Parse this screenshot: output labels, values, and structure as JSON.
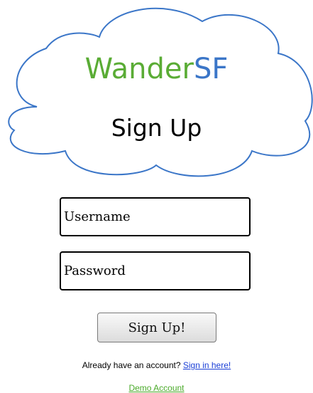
{
  "header": {
    "logo_part1": "Wander",
    "logo_part2": "SF",
    "title": "Sign Up"
  },
  "form": {
    "username_placeholder": "Username",
    "password_placeholder": "Password",
    "submit_label": "Sign Up!"
  },
  "footer": {
    "signin_prompt": "Already have an account?",
    "signin_link": "Sign in here!",
    "demo_link": "Demo Account"
  },
  "colors": {
    "brand_green": "#5aac35",
    "brand_blue": "#3b76c8",
    "cloud_outline": "#3b76c8",
    "signin_link": "#1a3fd6",
    "demo_link": "#4aaa2a"
  }
}
